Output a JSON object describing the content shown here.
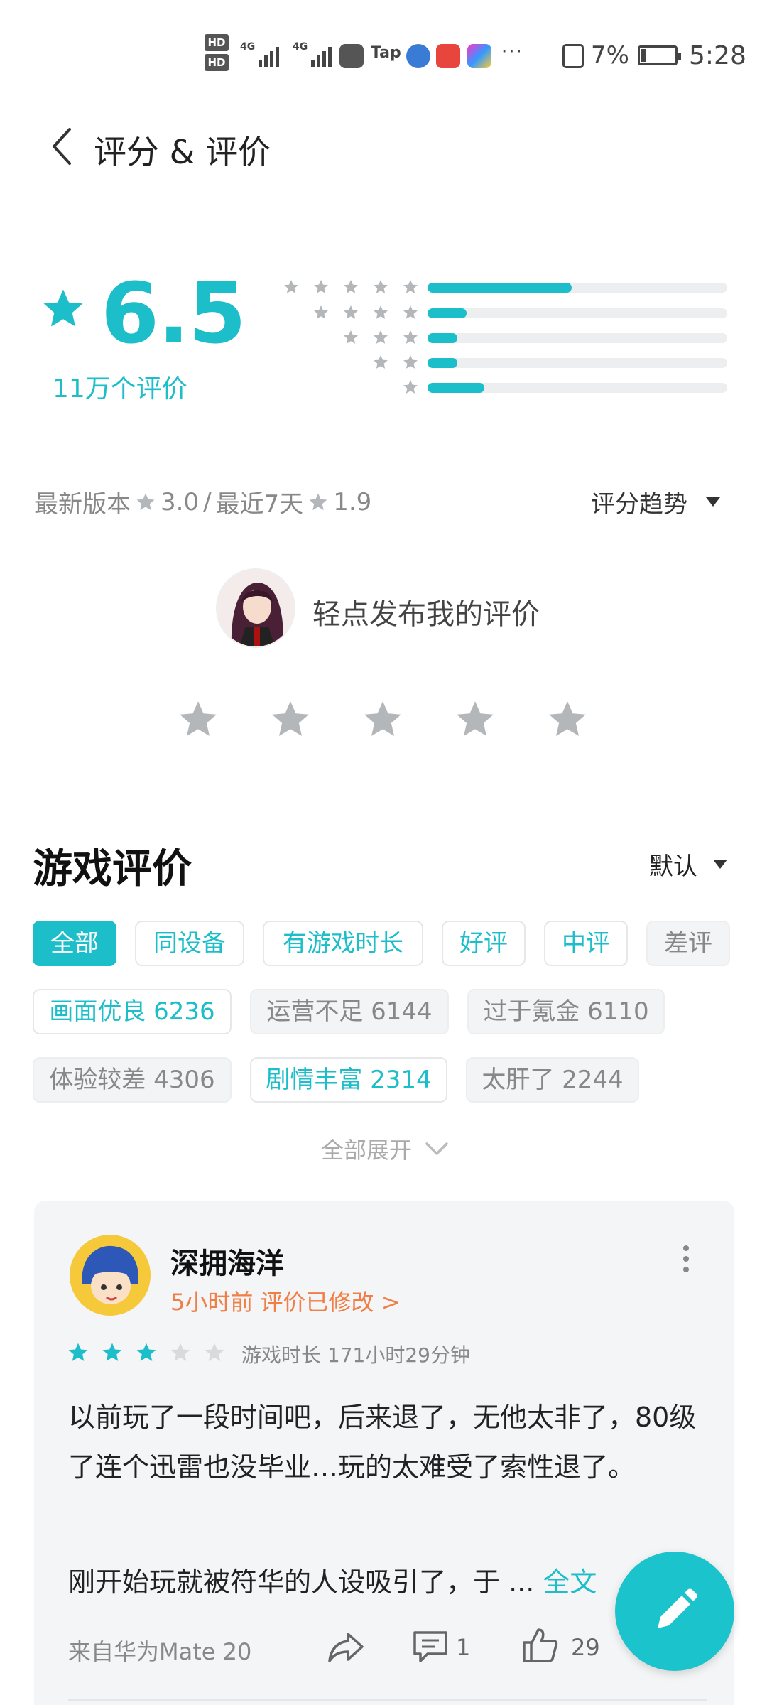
{
  "status_bar": {
    "hd1": "HD",
    "hd2": "HD",
    "net1": "4G",
    "net2": "4G",
    "tap": "Tap",
    "more": "···",
    "battery_pct": "7%",
    "time": "5:28"
  },
  "header": {
    "title": "评分 & 评价"
  },
  "rating": {
    "score": "6.5",
    "count_label": "11万个评价",
    "distribution": [
      {
        "stars": 5,
        "fraction": 0.48
      },
      {
        "stars": 4,
        "fraction": 0.13
      },
      {
        "stars": 3,
        "fraction": 0.1
      },
      {
        "stars": 2,
        "fraction": 0.1
      },
      {
        "stars": 1,
        "fraction": 0.19
      }
    ],
    "latest_version_label": "最新版本",
    "latest_version_score": "3.0",
    "separator": "/",
    "recent_label": "最近7天",
    "recent_score": "1.9",
    "trend_label": "评分趋势"
  },
  "post_review": {
    "prompt": "轻点发布我的评价"
  },
  "reviews": {
    "section_title": "游戏评价",
    "sort_label": "默认",
    "filter_chips": [
      {
        "label": "全部",
        "style": "active"
      },
      {
        "label": "同设备",
        "style": "teal"
      },
      {
        "label": "有游戏时长",
        "style": "teal"
      },
      {
        "label": "好评",
        "style": "teal"
      },
      {
        "label": "中评",
        "style": "teal"
      },
      {
        "label": "差评",
        "style": "grey"
      }
    ],
    "tag_chips": [
      {
        "label": "画面优良 6236",
        "style": "teal"
      },
      {
        "label": "运营不足 6144",
        "style": "grey"
      },
      {
        "label": "过于氪金 6110",
        "style": "grey"
      },
      {
        "label": "体验较差 4306",
        "style": "grey"
      },
      {
        "label": "剧情丰富 2314",
        "style": "teal"
      },
      {
        "label": "太肝了 2244",
        "style": "grey"
      }
    ],
    "expand_label": "全部展开",
    "items": [
      {
        "user_name": "深拥海洋",
        "time_label": "5小时前 评价已修改 >",
        "rating": 3,
        "playtime": "游戏时长 171小时29分钟",
        "body": "以前玩了一段时间吧，后来退了，无他太非了，80级了连个迅雷也没毕业…玩的太难受了索性退了。",
        "body2": "刚开始玩就被符华的人设吸引了，于 ... ",
        "more_label": "全文",
        "device": "来自华为Mate 20",
        "comment_count": "1",
        "like_count": "29"
      }
    ]
  },
  "colors": {
    "accent": "#1bbec9",
    "orange": "#f07e46",
    "star_grey": "#b3b7ba"
  }
}
